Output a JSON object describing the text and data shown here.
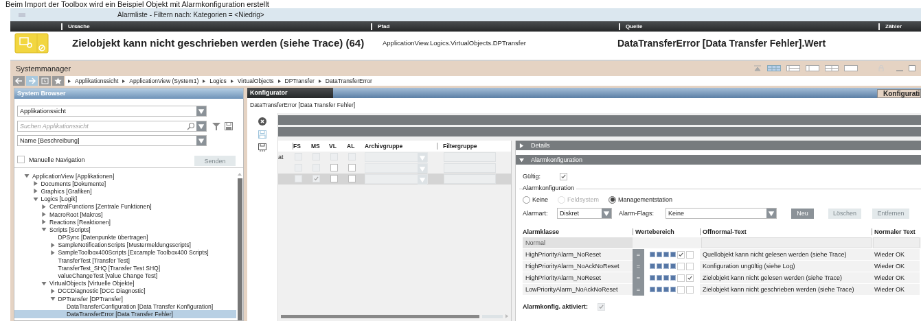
{
  "caption": "Beim Import der Toolbox wird ein Beispiel Objekt mit Alarmkonfiguration erstellt",
  "alarm_list": {
    "title": "Alarmliste - Filtern nach: Kategorien = <Niedrig>",
    "columns": [
      "Ursache",
      "Pfad",
      "Quelle",
      "Zähler"
    ],
    "row": {
      "cause": "Zielobjekt kann nicht geschrieben werden (siehe Trace) (64)",
      "path": "ApplicationView.Logics.VirtualObjects.DPTransfer",
      "source": "DataTransferError [Data Transfer Fehler].Wert"
    }
  },
  "system_manager": {
    "title": "Systemmanager",
    "breadcrumb": [
      "Applikationssicht",
      "ApplicationView (System1)",
      "Logics",
      "VirtualObjects",
      "DPTransfer",
      "DataTransferError"
    ]
  },
  "system_browser": {
    "title": "System Browser",
    "view": "Applikationssicht",
    "search": {
      "placeholder": "Suchen Applikationssicht"
    },
    "display": "Name [Beschreibung]",
    "manual_navigation": {
      "label": "Manuelle Navigation",
      "checked": false
    },
    "send_button": {
      "label": "Senden",
      "disabled": true
    },
    "tree": [
      {
        "label": "ApplicationView [Applikationen]",
        "kind": "folder",
        "expanded": true,
        "selected": false,
        "children": [
          {
            "label": "Documents [Dokumente]",
            "kind": "folder",
            "expanded": false,
            "selected": false
          },
          {
            "label": "Graphics [Grafiken]",
            "kind": "folder",
            "expanded": false,
            "selected": false
          },
          {
            "label": "Logics [Logik]",
            "kind": "folder",
            "expanded": true,
            "selected": false,
            "children": [
              {
                "label": "CentralFunctions [Zentrale Funktionen]",
                "kind": "folder",
                "expanded": false,
                "selected": false
              },
              {
                "label": "MacroRoot [Makros]",
                "kind": "folder",
                "expanded": false,
                "selected": false
              },
              {
                "label": "Reactions [Reaktionen]",
                "kind": "folder",
                "expanded": false,
                "selected": false
              },
              {
                "label": "Scripts [Scripts]",
                "kind": "folder",
                "expanded": true,
                "selected": false,
                "children": [
                  {
                    "label": "DPSync [Datenpunkte übertragen]",
                    "kind": "item",
                    "selected": false
                  },
                  {
                    "label": "SampleNotificationScripts [Mustermeldungsscripts]",
                    "kind": "folder",
                    "expanded": false,
                    "selected": false
                  },
                  {
                    "label": "SampleToolbox400Scripts [Excample Toolbox400 Scripts]",
                    "kind": "folder",
                    "expanded": false,
                    "selected": false
                  },
                  {
                    "label": "TransferTest [Transfer Test]",
                    "kind": "item",
                    "selected": false
                  },
                  {
                    "label": "TransferTest_SHQ [Transfer Test SHQ]",
                    "kind": "item",
                    "selected": false
                  },
                  {
                    "label": "valueChangeTest [value Change Test]",
                    "kind": "item",
                    "selected": false
                  }
                ]
              },
              {
                "label": "VirtualObjects [Virtuelle Objekte]",
                "kind": "folder",
                "expanded": true,
                "selected": false,
                "children": [
                  {
                    "label": "DCCDiagnostic [DCC Diagnostic]",
                    "kind": "folder",
                    "expanded": false,
                    "selected": false
                  },
                  {
                    "label": "DPTransfer [DPTransfer]",
                    "kind": "folder",
                    "expanded": true,
                    "selected": false,
                    "children": [
                      {
                        "label": "DataTransferConfiguration [Data Transfer Konfiguration]",
                        "kind": "item",
                        "selected": false
                      },
                      {
                        "label": "DataTransferError [Data Transfer Fehler]",
                        "kind": "item",
                        "selected": true
                      }
                    ]
                  }
                ]
              }
            ]
          }
        ]
      }
    ]
  },
  "configurator": {
    "title": "Konfigurator",
    "tab": "Konfigurati",
    "object": "DataTransferError [Data Transfer Fehler]",
    "grid": {
      "columns": [
        "FS",
        "MS",
        "VL",
        "AL",
        "Archivgruppe",
        "Filtergruppe"
      ],
      "rows": [
        {
          "label": "at",
          "selected": false,
          "flags": [
            {
              "checked": false,
              "disabled": true
            },
            {
              "checked": false,
              "disabled": true
            },
            {
              "checked": false,
              "disabled": true
            },
            {
              "checked": false,
              "disabled": true
            }
          ]
        },
        {
          "selected": false,
          "flags": [
            {
              "checked": false,
              "disabled": true
            },
            {
              "checked": false,
              "disabled": true
            },
            {
              "checked": false,
              "disabled": false
            },
            {
              "checked": false,
              "disabled": false
            }
          ]
        },
        {
          "selected": true,
          "flags": [
            {
              "checked": false,
              "disabled": true
            },
            {
              "checked": true,
              "disabled": true
            },
            {
              "checked": false,
              "disabled": false
            },
            {
              "checked": false,
              "disabled": false
            }
          ]
        }
      ]
    },
    "details": {
      "title": "Details",
      "expanded": false
    },
    "alarm_config": {
      "title": "Alarmkonfiguration",
      "expanded": true,
      "valid": {
        "label": "Gültig:",
        "checked": true
      },
      "group_label": "Alarmkonfiguration",
      "modes": [
        {
          "label": "Keine",
          "selected": false,
          "disabled": false
        },
        {
          "label": "Feldsystem",
          "selected": false,
          "disabled": true
        },
        {
          "label": "Managementstation",
          "selected": true,
          "disabled": false
        }
      ],
      "alarm_type": {
        "label": "Alarmart:",
        "value": "Diskret"
      },
      "alarm_flags": {
        "label": "Alarm-Flags:",
        "value": "Keine"
      },
      "buttons": [
        {
          "label": "Neu",
          "disabled": false
        },
        {
          "label": "Löschen",
          "disabled": true
        },
        {
          "label": "Entfernen",
          "disabled": true
        }
      ],
      "table": {
        "columns": [
          "Alarmklasse",
          "Wertebereich",
          "Offnormal-Text",
          "Normaler Text"
        ],
        "rows": [
          {
            "kind": "normal",
            "class": "Normal"
          },
          {
            "kind": "alarm",
            "class": "HighPriorityAlarm_NoReset",
            "operator": "=",
            "checks": [
              true,
              false
            ],
            "offnormal": "Quellobjekt kann nicht gelesen werden (siehe Trace)",
            "normal": "Wieder OK"
          },
          {
            "kind": "alarm",
            "class": "HighPriorityAlarm_NoAckNoReset",
            "operator": "=",
            "checks": [
              false,
              false
            ],
            "offnormal": "Konfiguration ungültig (siehe Log)",
            "normal": "Wieder OK"
          },
          {
            "kind": "alarm",
            "class": "HighPriorityAlarm_NoReset",
            "operator": "=",
            "checks": [
              false,
              true
            ],
            "offnormal": "Zielobjekt kann nicht gelesen werden (siehe Trace)",
            "normal": "Wieder OK"
          },
          {
            "kind": "alarm",
            "class": "LowPriorityAlarm_NoAckNoReset",
            "operator": "=",
            "checks": [
              false,
              false
            ],
            "offnormal": "Zielobjekt kann nicht geschrieben werden (siehe Trace)",
            "normal": "Wieder OK"
          }
        ]
      },
      "activated": {
        "label": "Alarmkonfig. aktiviert:",
        "checked": true
      }
    }
  }
}
